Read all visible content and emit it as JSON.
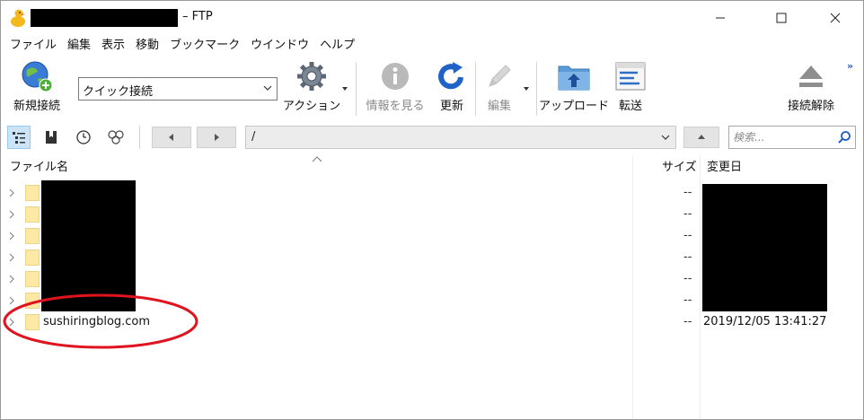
{
  "window": {
    "title": "– FTP",
    "controls": [
      "minimize",
      "maximize",
      "close"
    ]
  },
  "menu": [
    "ファイル",
    "編集",
    "表示",
    "移動",
    "ブックマーク",
    "ウインドウ",
    "ヘルプ"
  ],
  "toolbar": {
    "new_connection": "新規接続",
    "quick_connect_value": "クイック接続",
    "action": "アクション",
    "info": "情報を見る",
    "refresh": "更新",
    "edit": "編集",
    "upload": "アップロード",
    "transfer": "転送",
    "disconnect": "接続解除",
    "overflow": "»"
  },
  "navbar": {
    "path": "/",
    "search_placeholder": "検索..."
  },
  "list": {
    "headers": {
      "name": "ファイル名",
      "size": "サイズ",
      "modified": "変更日"
    },
    "rows": [
      {
        "name": "",
        "size": "--",
        "modified": ""
      },
      {
        "name": "",
        "size": "--",
        "modified": ""
      },
      {
        "name": "",
        "size": "--",
        "modified": ""
      },
      {
        "name": "",
        "size": "--",
        "modified": ""
      },
      {
        "name": "",
        "size": "--",
        "modified": ""
      },
      {
        "name": "",
        "size": "--",
        "modified": ""
      },
      {
        "name": "sushiringblog.com",
        "size": "--",
        "modified": "2019/12/05 13:41:27"
      }
    ]
  },
  "colors": {
    "annotation": "#e0141e",
    "folder": "#fde9a5",
    "nav_active": "#cce4f7"
  }
}
